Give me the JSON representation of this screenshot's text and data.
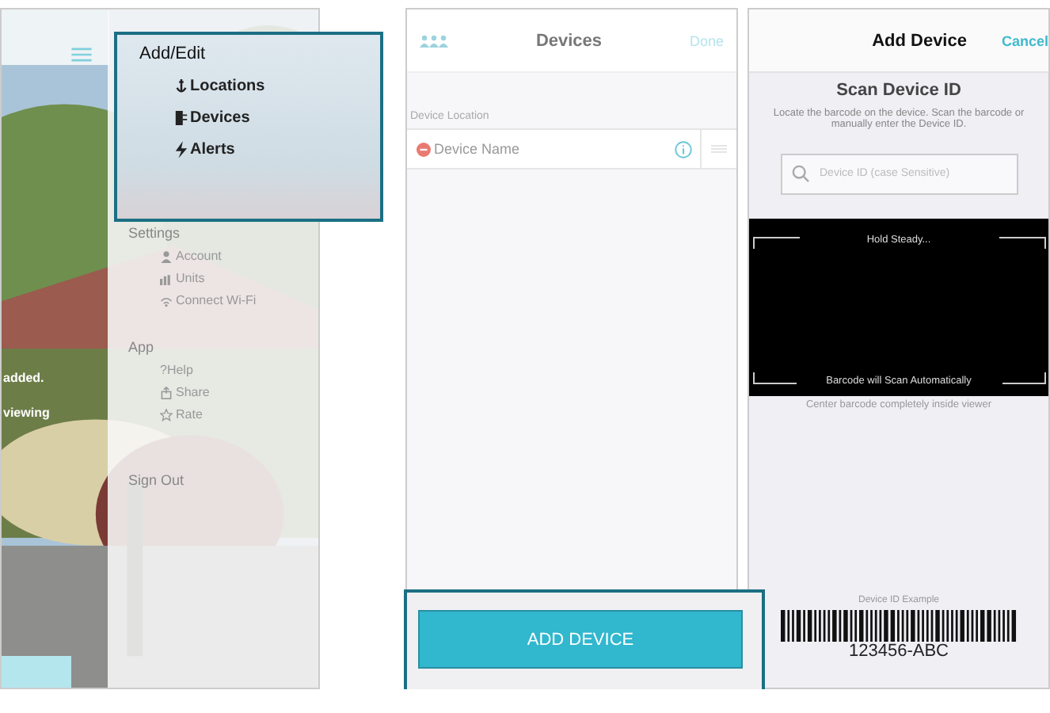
{
  "menu_screen": {
    "behind_text": [
      "added.",
      "viewing"
    ],
    "highlight": {
      "heading": "Add/Edit",
      "items": [
        {
          "label": "Locations"
        },
        {
          "label": "Devices"
        },
        {
          "label": "Alerts"
        }
      ]
    },
    "sections": [
      {
        "heading": "Settings",
        "items": [
          "Account",
          "Units",
          "Connect Wi-Fi"
        ]
      },
      {
        "heading": "App",
        "items": [
          "?Help",
          "Share",
          "Rate"
        ]
      }
    ],
    "sign_out": "Sign Out"
  },
  "devices_screen": {
    "title": "Devices",
    "done": "Done",
    "section": "Device Location",
    "rows": [
      {
        "name": "Device Name"
      }
    ],
    "button": "ADD DEVICE"
  },
  "scan_screen": {
    "title": "Add Device",
    "cancel": "Cancel",
    "heading": "Scan Device ID",
    "instructions": "Locate the barcode on the device. Scan the barcode or manually enter the Device ID.",
    "search": {
      "placeholder": "Device ID (case Sensitive)"
    },
    "viewer": {
      "top": "Hold Steady...",
      "bottom": "Barcode will Scan Automatically"
    },
    "hint": "Center barcode completely inside viewer",
    "example_label": "Device ID Example",
    "example_code": "123456-ABC"
  }
}
